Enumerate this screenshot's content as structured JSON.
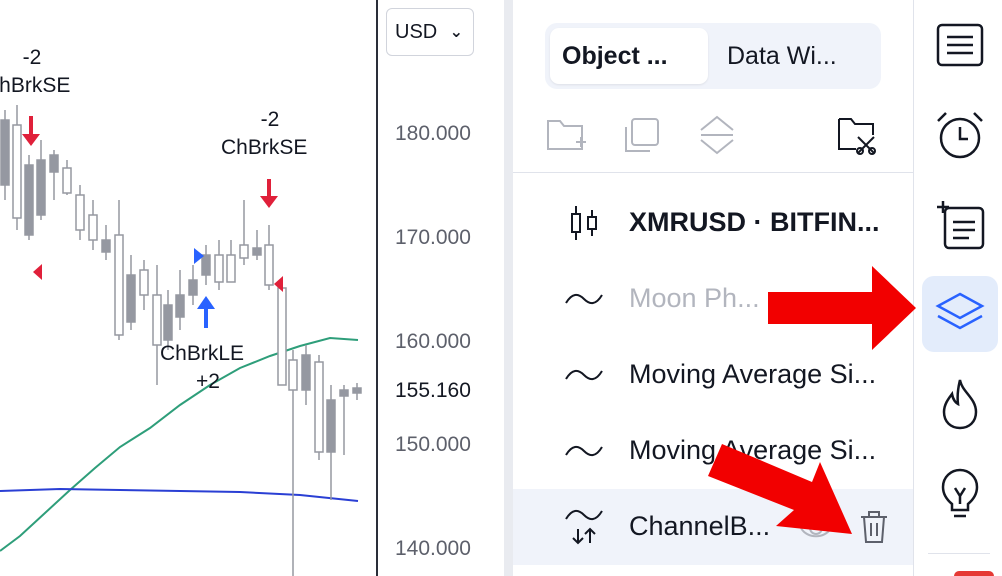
{
  "chart": {
    "signals": [
      {
        "qty": "-2",
        "name": "ChBrkSE"
      },
      {
        "qty": "-2",
        "name": "ChBrkSE"
      },
      {
        "name": "ChBrkLE",
        "qty": "+2"
      }
    ]
  },
  "price_scale": {
    "currency": "USD",
    "ticks": [
      "180.000",
      "170.000",
      "160.000",
      "150.000",
      "140.000"
    ],
    "last_price": "155.160"
  },
  "panel": {
    "tabs": [
      {
        "label": "Object ...",
        "active": true
      },
      {
        "label": "Data Wi...",
        "active": false
      }
    ],
    "toolbar_icons": [
      "add-group-icon",
      "clone-icon",
      "move-order-icon",
      "manage-drawings-icon"
    ],
    "objects": [
      {
        "label": "XMRUSD · BITFIN...",
        "icon": "candlestick-icon",
        "bold": true,
        "dimmed": false
      },
      {
        "label": "Moon Ph...",
        "icon": "indicator-wave-icon",
        "bold": false,
        "dimmed": true
      },
      {
        "label": "Moving Average Si...",
        "icon": "indicator-wave-icon",
        "bold": false,
        "dimmed": false
      },
      {
        "label": "Moving Average Si...",
        "icon": "indicator-wave-icon",
        "bold": false,
        "dimmed": false
      },
      {
        "label": "ChannelB...",
        "icon": "strategy-icon",
        "bold": false,
        "dimmed": false,
        "selected": true
      }
    ]
  },
  "right_toolbar": {
    "items": [
      "watchlist-icon",
      "alerts-icon",
      "add-note-icon",
      "object-tree-icon",
      "hotlists-icon",
      "ideas-icon"
    ],
    "active": "object-tree-icon"
  },
  "colors": {
    "accent_blue": "#2962ff",
    "signal_red": "#e0203a",
    "annotation_red": "#f20000",
    "ma_green": "#2e9e7a",
    "ma_blue": "#2a3fd4",
    "candle_gray": "#9598a1",
    "active_tab_bg": "#e3ecfb"
  }
}
